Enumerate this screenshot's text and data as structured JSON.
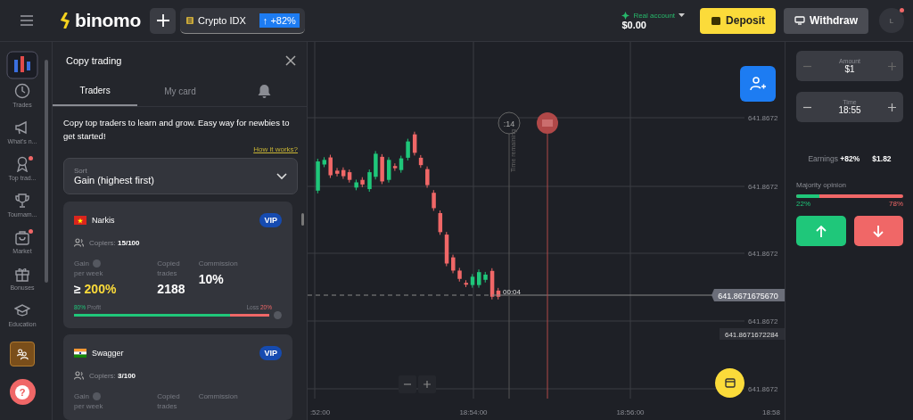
{
  "topbar": {
    "logo": "binomo",
    "asset": {
      "name": "Crypto IDX",
      "payout": "↑ +82%"
    },
    "account": {
      "label": "Real account",
      "balance": "$0.00"
    },
    "deposit": "Deposit",
    "withdraw": "Withdraw",
    "avatar": "L",
    "avatar_badge": true,
    "help": "?"
  },
  "sidebar": {
    "items": [
      {
        "label": "Trades",
        "kind": "clock",
        "badge": false
      },
      {
        "label": "What's n...",
        "kind": "megaphone",
        "badge": false
      },
      {
        "label": "Top trad...",
        "kind": "award",
        "badge": true
      },
      {
        "label": "Tournam...",
        "kind": "trophy",
        "badge": false
      },
      {
        "label": "Market",
        "kind": "bag",
        "badge": true
      },
      {
        "label": "Bonuses",
        "kind": "gift",
        "badge": false
      },
      {
        "label": "Education",
        "kind": "cap",
        "badge": false
      }
    ]
  },
  "panel": {
    "title": "Copy trading",
    "tabs": [
      {
        "label": "Traders",
        "selected": true
      },
      {
        "label": "My card",
        "selected": false
      }
    ],
    "description": "Copy top traders to learn and grow. Easy way for newbies to get started!",
    "link": "How it works?",
    "sort": {
      "label": "Sort",
      "value": "Gain (highest first)"
    },
    "traders": [
      {
        "name": "Narkis",
        "kind": "vietnam",
        "vip": "VIP",
        "copiers_label": "Copiers:",
        "copiers": "15/100",
        "gain_label": "Gain",
        "gain_sub": "per week",
        "gain": "≥ ",
        "gain_value": "200%",
        "copied_label": "Copied trades",
        "copied": "2188",
        "commission_label": "Commission",
        "commission": "10%",
        "profit": "80%",
        "profit_label": "Profit",
        "loss_label": "Loss",
        "loss": "20%",
        "level": 0.8
      },
      {
        "name": "Swagger",
        "kind": "india",
        "vip": "VIP",
        "copiers_label": "Copiers:",
        "copiers": "3/100",
        "gain_label": "Gain",
        "gain_sub": "per week",
        "copied_label": "Copied trades",
        "commission_label": "Commission"
      }
    ]
  },
  "chart": {
    "y_labels": [
      "641.8672",
      "641.8672",
      "641.8672",
      "641.8672",
      "641.8672"
    ],
    "x_labels": [
      ":52:00",
      "18:54:00",
      "18:56:00",
      "18:58"
    ],
    "countdown": ":14",
    "time_remaining": "Time remaining",
    "timer": "00:04",
    "price": "641.8671675670",
    "price_2": "641.8671672284"
  },
  "trade": {
    "amount_label": "Amount",
    "amount": "$1",
    "time_label": "Time",
    "time": "18:55",
    "earnings_label": "Earnings",
    "earnings_pct": "+82%",
    "earnings": "$1.82",
    "opinion_label": "Majority opinion",
    "up": "22%",
    "down": "78%",
    "level": 0.22
  }
}
